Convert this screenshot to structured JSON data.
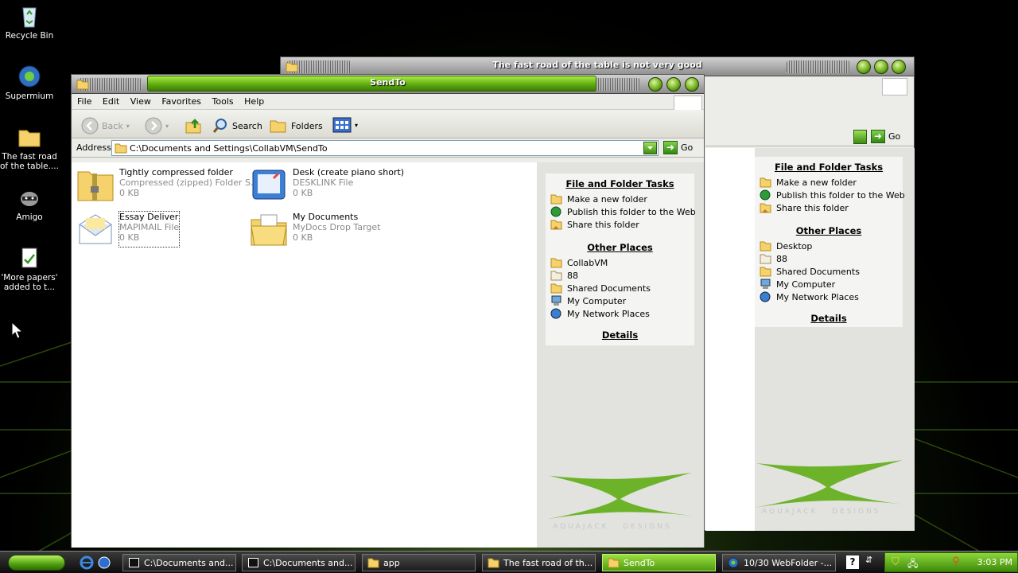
{
  "desktop": {
    "icons": [
      {
        "label": "Recycle Bin",
        "icon": "recycle-bin-icon"
      },
      {
        "label": "Supermium",
        "icon": "browser-icon"
      },
      {
        "label": "The fast road of the table....",
        "icon": "folder-icon"
      },
      {
        "label": "Amigo",
        "icon": "raccoon-icon"
      },
      {
        "label": "'More papers' added to t...",
        "icon": "document-icon"
      }
    ]
  },
  "back_window": {
    "title": "The fast road of the table is not very good",
    "go_label": "Go",
    "file_tasks": {
      "header": "File and Folder Tasks",
      "items": [
        "Make a new folder",
        "Publish this folder to the Web",
        "Share this folder"
      ]
    },
    "other_places": {
      "header": "Other Places",
      "items": [
        "Desktop",
        "88",
        "Shared Documents",
        "My Computer",
        "My Network Places"
      ]
    },
    "details": "Details",
    "brand": "AQUAJACK   DESIGNS"
  },
  "front_window": {
    "title": "SendTo",
    "menu": [
      "File",
      "Edit",
      "View",
      "Favorites",
      "Tools",
      "Help"
    ],
    "toolbar": {
      "back": "Back",
      "search": "Search",
      "folders": "Folders"
    },
    "address": {
      "label": "Address",
      "value": "C:\\Documents and Settings\\CollabVM\\SendTo",
      "go": "Go"
    },
    "files": [
      {
        "name": "Tightly compressed folder",
        "type": "Compressed (zipped) Folder S...",
        "size": "0 KB",
        "icon": "zip-folder-icon"
      },
      {
        "name": "Desk (create piano short)",
        "type": "DESKLINK File",
        "size": "0 KB",
        "icon": "desklink-icon"
      },
      {
        "name": "Essay Deliver",
        "type": "MAPIMAIL File",
        "size": "0 KB",
        "icon": "mail-icon"
      },
      {
        "name": "My Documents",
        "type": "MyDocs Drop Target",
        "size": "0 KB",
        "icon": "mydocs-icon"
      }
    ],
    "file_tasks": {
      "header": "File and Folder Tasks",
      "items": [
        "Make a new folder",
        "Publish this folder to the Web",
        "Share this folder"
      ]
    },
    "other_places": {
      "header": "Other Places",
      "items": [
        "CollabVM",
        "88",
        "Shared Documents",
        "My Computer",
        "My Network Places"
      ]
    },
    "details": "Details",
    "brand": "AQUAJACK   DESIGNS"
  },
  "taskbar": {
    "buttons": [
      {
        "label": "C:\\Documents and...",
        "icon": "7zip-icon",
        "active": false
      },
      {
        "label": "C:\\Documents and...",
        "icon": "7zip-icon",
        "active": false
      },
      {
        "label": "app",
        "icon": "folder-icon",
        "active": false
      },
      {
        "label": "The fast road of th...",
        "icon": "folder-icon",
        "active": false
      },
      {
        "label": "SendTo",
        "icon": "folder-icon",
        "active": true
      },
      {
        "label": "10/30 WebFolder -...",
        "icon": "browser-icon",
        "active": false
      }
    ],
    "clock": "3:03 PM"
  },
  "colors": {
    "accent": "#5aa80e",
    "title_text": "#ffffff"
  }
}
